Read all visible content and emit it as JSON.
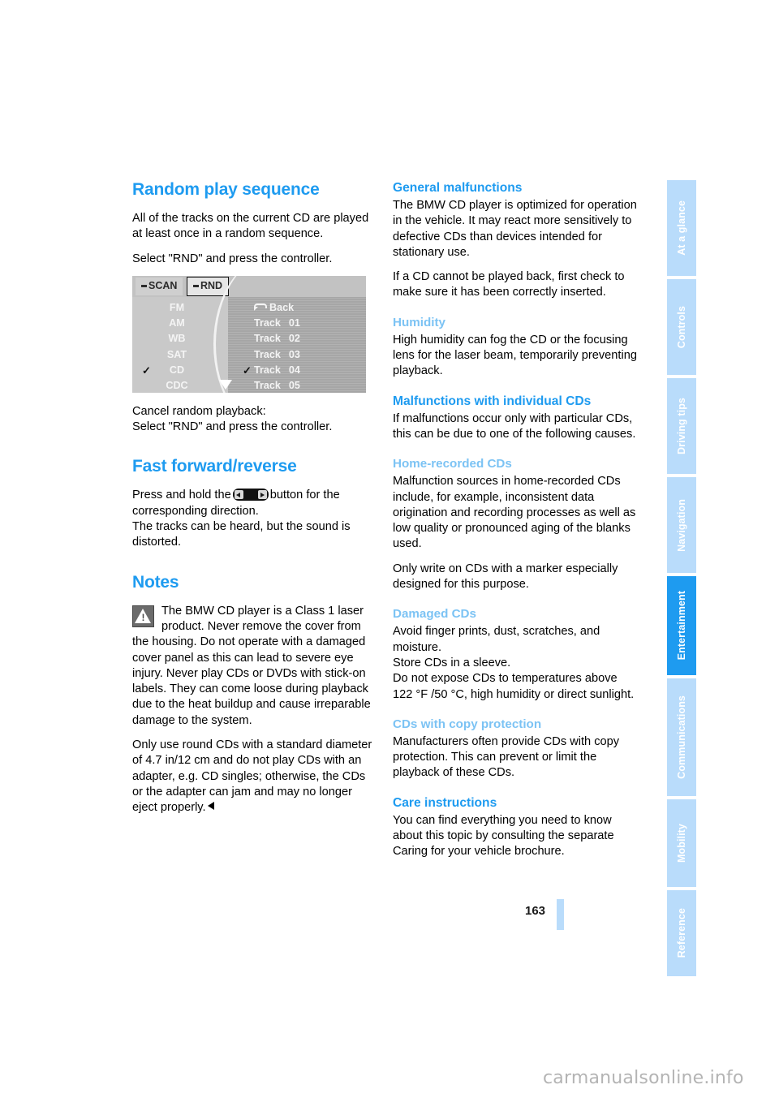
{
  "document": {
    "page_number": "163",
    "watermark": "carmanualsonline.info"
  },
  "sidebar": {
    "tabs": [
      {
        "label": "At a glance",
        "active": false
      },
      {
        "label": "Controls",
        "active": false
      },
      {
        "label": "Driving tips",
        "active": false
      },
      {
        "label": "Navigation",
        "active": false
      },
      {
        "label": "Entertainment",
        "active": true
      },
      {
        "label": "Communications",
        "active": false
      },
      {
        "label": "Mobility",
        "active": false
      },
      {
        "label": "Reference",
        "active": false
      }
    ],
    "colors": {
      "inactive": "#b9dcfb",
      "active": "#1e9bf0",
      "text": "#ffffff"
    }
  },
  "colors": {
    "heading_primary": "#1e9bf0",
    "heading_secondary": "#7cc3f4",
    "body_text": "#000000"
  },
  "left_column": {
    "heading": "Random play sequence",
    "para_1": "All of the tracks on the current CD are played at least once in a random sequence.",
    "para_2": "Select \"RND\" and press the controller.",
    "figure": {
      "alt": "iDrive CD audio menu with RND highlighted",
      "tabs": [
        "SCAN",
        "RND"
      ],
      "selected_tab": "RND",
      "sources": [
        "FM",
        "AM",
        "WB",
        "SAT",
        "CD",
        "CDC"
      ],
      "selected_source": "CD",
      "back_label": "Back",
      "tracks": [
        {
          "label": "Track",
          "number": "01"
        },
        {
          "label": "Track",
          "number": "02"
        },
        {
          "label": "Track",
          "number": "03"
        },
        {
          "label": "Track",
          "number": "04"
        },
        {
          "label": "Track",
          "number": "05"
        }
      ],
      "selected_track": "Track 04",
      "image_code": "hhdKw5b1"
    },
    "para_3": "Cancel random playback:",
    "para_4": "Select \"RND\" and press the controller.",
    "heading_2": "Fast forward/reverse",
    "para_5_before": "Press and hold the",
    "para_5_after": "button for the corresponding direction.",
    "para_6": "The tracks can be heard, but the sound is distorted.",
    "heading_3": "Notes",
    "note": "The BMW CD player is a Class 1 laser product. Never remove the cover from the housing. Do not operate with a damaged cover panel as this can lead to severe eye injury. Never play CDs or DVDs with stick-on labels. They can come loose during playback due to the heat buildup and cause irreparable damage to the system.",
    "note_2": "Only use round CDs with a standard diameter of 4.7 in/12 cm and do not play CDs with an adapter, e.g. CD singles; otherwise, the CDs or the adapter can jam and may no longer eject properly."
  },
  "right_column": {
    "sections": [
      {
        "level": "h2",
        "heading": "General malfunctions",
        "paragraphs": [
          "The BMW CD player is optimized for operation in the vehicle. It may react more sensitively to defective CDs than devices intended for stationary use.",
          "If a CD cannot be played back, first check to make sure it has been correctly inserted."
        ]
      },
      {
        "level": "h3",
        "heading": "Humidity",
        "paragraphs": [
          "High humidity can fog the CD or the focusing lens for the laser beam, temporarily preventing playback."
        ]
      },
      {
        "level": "h2",
        "heading": "Malfunctions with individual CDs",
        "paragraphs": [
          "If malfunctions occur only with particular CDs, this can be due to one of the following causes."
        ]
      },
      {
        "level": "h3",
        "heading": "Home-recorded CDs",
        "paragraphs": [
          "Malfunction sources in home-recorded CDs include, for example, inconsistent data origination and recording processes as well as low quality or pronounced aging of the blanks used.",
          "Only write on CDs with a marker especially designed for this purpose."
        ]
      },
      {
        "level": "h3",
        "heading": "Damaged CDs",
        "paragraphs": [
          "Avoid finger prints, dust, scratches, and moisture.\nStore CDs in a sleeve.\nDo not expose CDs to temperatures above 122 °F /50 °C, high humidity or direct sunlight."
        ]
      },
      {
        "level": "h3",
        "heading": "CDs with copy protection",
        "paragraphs": [
          "Manufacturers often provide CDs with copy protection. This can prevent or limit the playback of these CDs."
        ]
      },
      {
        "level": "h2",
        "heading": "Care instructions",
        "paragraphs": [
          "You can find everything you need to know about this topic by consulting the separate Caring for your vehicle brochure."
        ]
      }
    ]
  }
}
